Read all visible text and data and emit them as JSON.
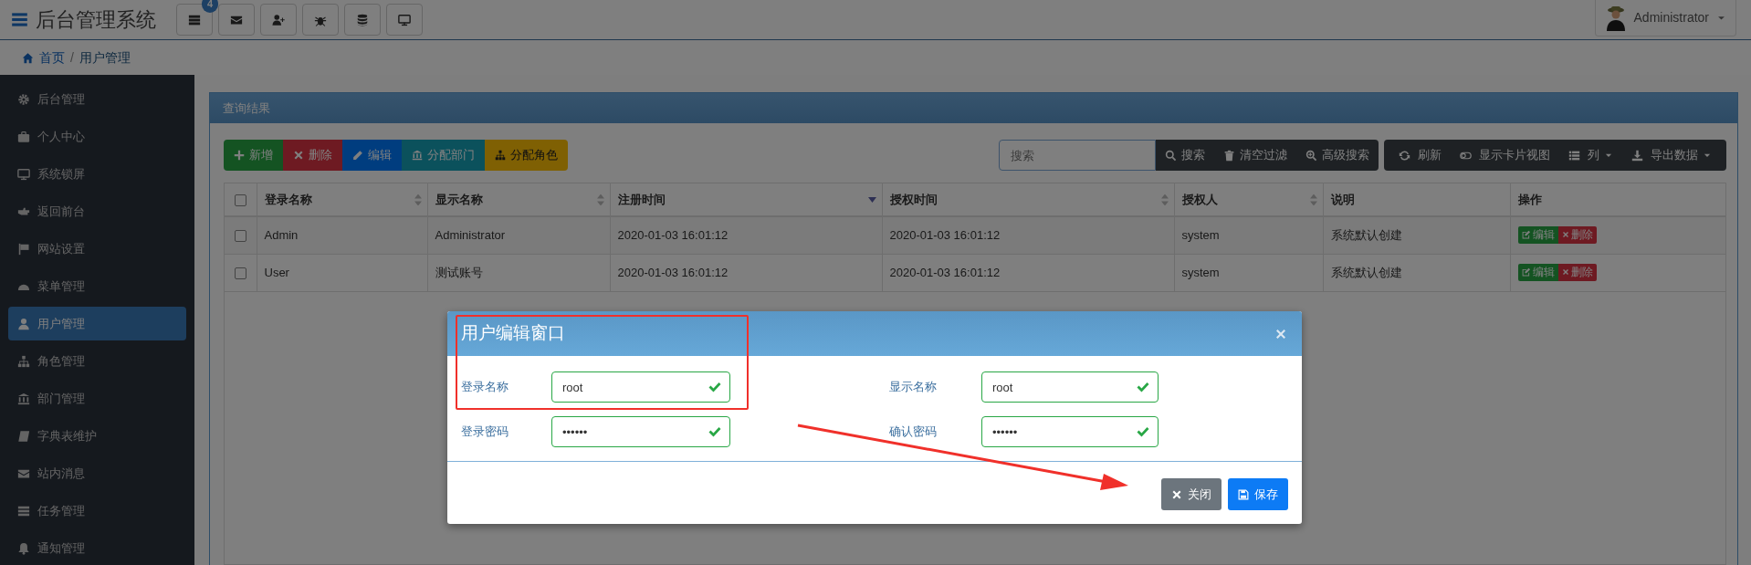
{
  "app": {
    "title": "后台管理系统",
    "badge": "4"
  },
  "user": {
    "name": "Administrator"
  },
  "breadcrumb": {
    "separator": "/",
    "items": [
      {
        "label": "首页",
        "selected": false
      },
      {
        "label": "用户管理",
        "selected": true
      }
    ]
  },
  "sidebar": {
    "items": [
      {
        "label": "后台管理",
        "selected": false
      },
      {
        "label": "个人中心",
        "selected": false
      },
      {
        "label": "系统锁屏",
        "selected": false
      },
      {
        "label": "返回前台",
        "selected": false
      },
      {
        "label": "网站设置",
        "selected": false
      },
      {
        "label": "菜单管理",
        "selected": false
      },
      {
        "label": "用户管理",
        "selected": true
      },
      {
        "label": "角色管理",
        "selected": false
      },
      {
        "label": "部门管理",
        "selected": false
      },
      {
        "label": "字典表维护",
        "selected": false
      },
      {
        "label": "站内消息",
        "selected": false
      },
      {
        "label": "任务管理",
        "selected": false
      },
      {
        "label": "通知管理",
        "selected": false
      }
    ]
  },
  "panel": {
    "title": "查询结果"
  },
  "toolbar": {
    "actions": [
      {
        "label": "新增",
        "kind": "success"
      },
      {
        "label": "删除",
        "kind": "danger"
      },
      {
        "label": "编辑",
        "kind": "primary"
      },
      {
        "label": "分配部门",
        "kind": "info"
      },
      {
        "label": "分配角色",
        "kind": "warning"
      }
    ],
    "search": {
      "placeholder": "搜索"
    },
    "search_actions": [
      "搜索",
      "清空过滤",
      "高级搜索"
    ],
    "view_actions": [
      {
        "label": "刷新",
        "dropdown": false
      },
      {
        "label": "显示卡片视图",
        "dropdown": false
      },
      {
        "label": "列",
        "dropdown": true
      },
      {
        "label": "导出数据",
        "dropdown": true
      }
    ]
  },
  "table": {
    "header_checked": false,
    "columns": [
      {
        "label": "登录名称",
        "sortable": true,
        "sorted_desc": false
      },
      {
        "label": "显示名称",
        "sortable": true,
        "sorted_desc": false
      },
      {
        "label": "注册时间",
        "sortable": true,
        "sorted_desc": true
      },
      {
        "label": "授权时间",
        "sortable": true,
        "sorted_desc": false
      },
      {
        "label": "授权人",
        "sortable": true,
        "sorted_desc": false
      },
      {
        "label": "说明",
        "sortable": false
      },
      {
        "label": "操作",
        "sortable": false
      }
    ],
    "rows": [
      {
        "checked": false,
        "cells": [
          "Admin",
          "Administrator",
          "2020-01-03 16:01:12",
          "2020-01-03 16:01:12",
          "system",
          "系统默认创建"
        ],
        "actions": [
          "编辑",
          "删除"
        ]
      },
      {
        "checked": false,
        "cells": [
          "User",
          "测试账号",
          "2020-01-03 16:01:12",
          "2020-01-03 16:01:12",
          "system",
          "系统默认创建"
        ],
        "actions": [
          "编辑",
          "删除"
        ]
      }
    ]
  },
  "modal": {
    "title": "用户编辑窗口",
    "fields": [
      {
        "label": "登录名称",
        "value": "root",
        "valid": true
      },
      {
        "label": "显示名称",
        "value": "root",
        "valid": true
      },
      {
        "label": "登录密码",
        "value": "••••••",
        "valid": true
      },
      {
        "label": "确认密码",
        "value": "••••••",
        "valid": true
      }
    ],
    "buttons": [
      {
        "label": "关闭",
        "kind": "secondary"
      },
      {
        "label": "保存",
        "kind": "primary"
      }
    ]
  }
}
